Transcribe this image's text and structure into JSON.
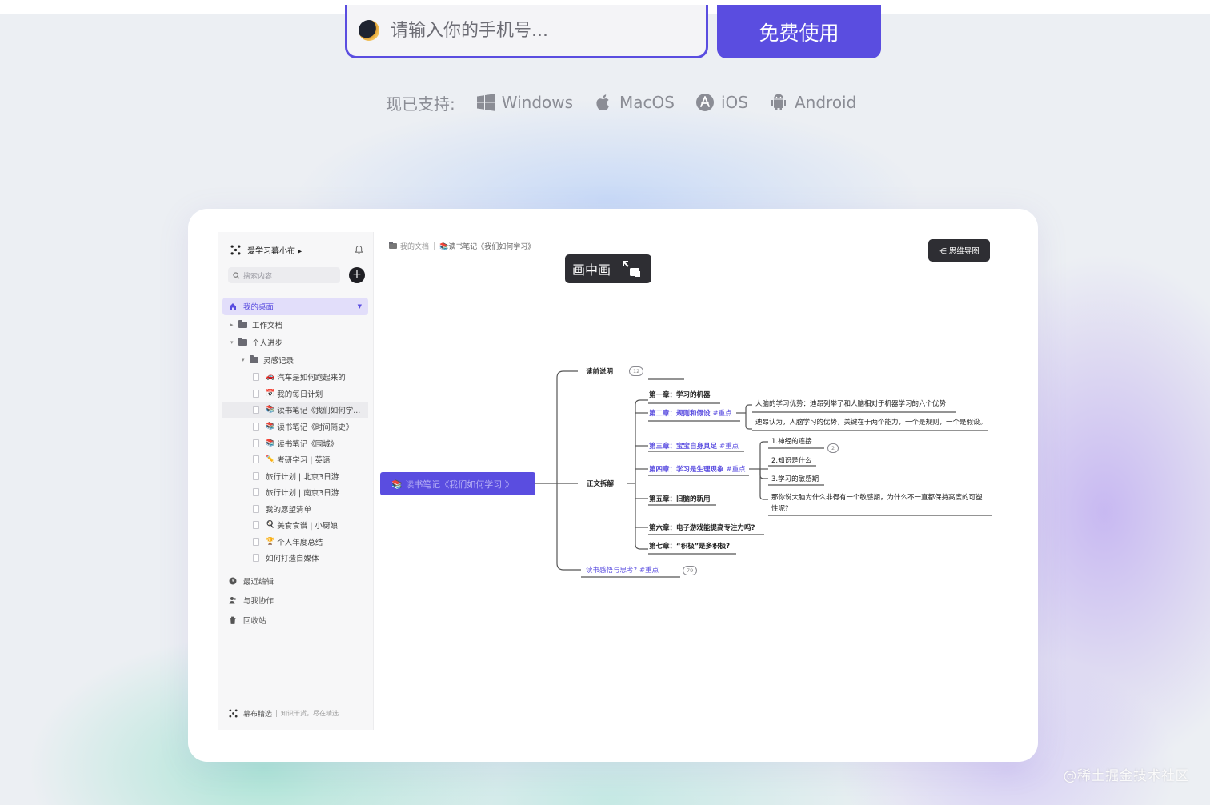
{
  "hero": {
    "phone_placeholder": "请输入你的手机号...",
    "cta_label": "免费使用",
    "support_label": "现已支持:",
    "platforms": [
      "Windows",
      "MacOS",
      "iOS",
      "Android"
    ]
  },
  "app": {
    "workspace_name": "爱学习幕小布 ▸",
    "search_placeholder": "搜索内容",
    "add_label": "+",
    "home_label": "我的桌面",
    "tree": [
      {
        "label": "工作文档",
        "emoji": ""
      },
      {
        "label": "个人进步",
        "emoji": ""
      },
      {
        "label": "灵感记录",
        "emoji": ""
      },
      {
        "label": "汽车是如何跑起来的",
        "emoji": "🚗"
      },
      {
        "label": "我的每日计划",
        "emoji": "📅"
      },
      {
        "label": "读书笔记《我们如何学...",
        "emoji": "📚"
      },
      {
        "label": "读书笔记《时间简史》",
        "emoji": "📚"
      },
      {
        "label": "读书笔记《围城》",
        "emoji": "📚"
      },
      {
        "label": "考研学习 | 英语",
        "emoji": "✏️"
      },
      {
        "label": "旅行计划 | 北京3日游",
        "emoji": ""
      },
      {
        "label": "旅行计划 | 南京3日游",
        "emoji": ""
      },
      {
        "label": "我的愿望清单",
        "emoji": ""
      },
      {
        "label": "美食食谱 | 小厨娘",
        "emoji": "🍳"
      },
      {
        "label": "个人年度总结",
        "emoji": "🏆"
      },
      {
        "label": "如何打造自媒体",
        "emoji": ""
      }
    ],
    "bottom_nav": [
      "最近编辑",
      "与我协作",
      "回收站"
    ],
    "footer_brand": "幕布精选",
    "footer_sep": "|",
    "footer_tagline": "知识干货，尽在精选",
    "breadcrumb": {
      "folder": "我的文档",
      "doc": "📚读书笔记《我们如何学习》"
    },
    "pip_label": "画中画",
    "mindmap_label": "⋲ 思维导图"
  },
  "mindmap": {
    "root": "📚 读书笔记《我们如何学习 》",
    "nodes": {
      "pre": "读前说明",
      "pre_count": "12",
      "main": "正文拆解",
      "ch1": "第一章：学习的机器",
      "ch2": "第二章：规则和假设",
      "ch2_tag": "#重点",
      "ch2_a": "人脑的学习优势：迪昂列举了和人脑相对于机器学习的六个优势",
      "ch2_b": "迪昂认为，人脑学习的优势，关键在于两个能力，一个是规则，一个是假设。",
      "ch3": "第三章：宝宝自身具足",
      "ch3_tag": "#重点",
      "ch4": "第四章：学习是生理现象",
      "ch4_tag": "#重点",
      "ch4_a": "1.神经的连接",
      "ch4_count": "2",
      "ch4_b": "2.知识是什么",
      "ch4_c": "3.学习的敏感期",
      "ch4_d1": "那你说大脑为什么非得有一个敏感期，为什么不一直都保持高度的可塑",
      "ch4_d2": "性呢?",
      "ch5": "第五章：旧脑的新用",
      "ch6": "第六章：电子游戏能提高专注力吗?",
      "ch7": "第七章：“积极”是多积极?",
      "thoughts": "读书感悟与思考?",
      "thoughts_tag": "#重点",
      "thoughts_count": "79"
    }
  },
  "watermark": "@稀土掘金技术社区",
  "colors": {
    "accent": "#5a4de0",
    "dark_button": "#2e2e33"
  }
}
